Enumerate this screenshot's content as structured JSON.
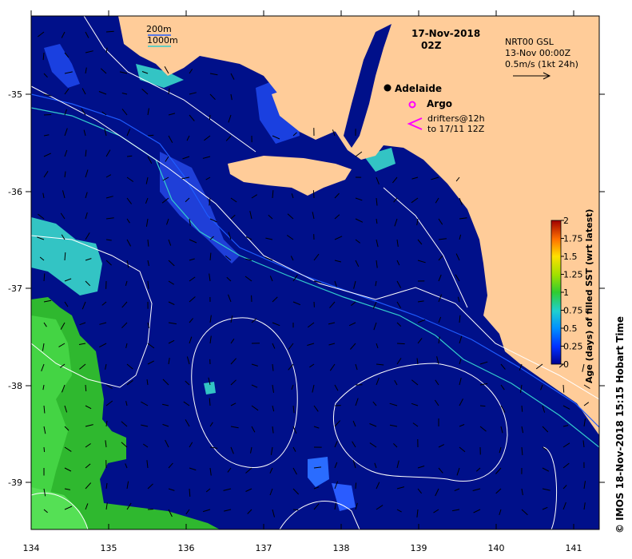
{
  "map": {
    "date": "17-Nov-2018",
    "time": "02Z",
    "place_label": "Adelaide",
    "lon_ticks": [
      "134",
      "135",
      "136",
      "137",
      "138",
      "139",
      "140",
      "141"
    ],
    "lat_ticks": [
      "-35",
      "-36",
      "-37",
      "-38",
      "-39"
    ],
    "colors": {
      "ocean": "#00108a",
      "land": "#ffcc99",
      "contour": "#ffffff",
      "isobath_200": "#2060ff",
      "isobath_1000": "#33cccc",
      "argo": "#ff00ff",
      "drifter": "#ff00ff",
      "age_green": "#33cc33",
      "age_cyan": "#33cccc",
      "age_blue": "#2a5cff"
    }
  },
  "legend": {
    "isobath_200": "200m",
    "isobath_1000": "1000m",
    "argo_label": "Argo",
    "drifter_line1": "drifters@12h",
    "drifter_line2": "to 17/11 12Z"
  },
  "currents": {
    "product": "NRT00 GSL",
    "valid": "13-Nov 00:00Z",
    "scale": "0.5m/s (1kt 24h)"
  },
  "colorbar": {
    "title": "Age (days) of filled SST (wrt latest)",
    "ticks": [
      "2",
      "1.75",
      "1.5",
      "1.25",
      "1",
      "0.75",
      "0.5",
      "0.25",
      "0"
    ]
  },
  "credit": "© IMOS 18-Nov-2018 15:15 Hobart Time"
}
